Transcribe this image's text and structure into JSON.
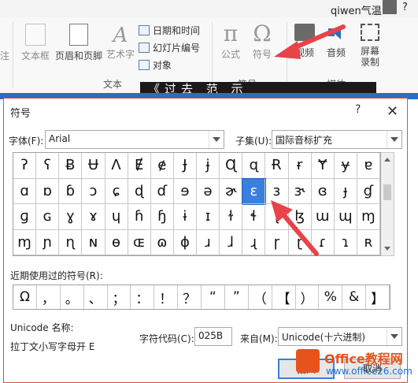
{
  "ribbon": {
    "user": "qiwen气温",
    "items": {
      "partial_left": "注",
      "textbox": "文本框",
      "header_footer": "页眉和页脚",
      "wordart": "艺术字",
      "datetime": "日期和时间",
      "slide_number": "幻灯片编号",
      "object": "对象",
      "equation": "公式",
      "symbol": "符号",
      "video": "视频",
      "audio": "音频",
      "screen_record": "屏幕录制"
    },
    "groups": {
      "text": "文本",
      "symbols": "符号",
      "media": "媒体"
    },
    "banner_text": "《过去  范  示"
  },
  "dialog": {
    "title": "符号",
    "help": "?",
    "close": "✕",
    "font_label": "字体(F):",
    "font_value": "Arial",
    "subset_label": "子集(U):",
    "subset_value": "国际音标扩充",
    "symbols": [
      [
        "ʔ",
        "ʕ",
        "Ƀ",
        "Ʉ",
        "Ʌ",
        "Ɇ",
        "ɇ",
        "Ɉ",
        "ɉ",
        "Ɋ",
        "ɋ",
        "Ɍ",
        "ɍ",
        "Ɏ",
        "ɏ",
        "ɐ"
      ],
      [
        "ɑ",
        "ɒ",
        "ɓ",
        "ɔ",
        "ɕ",
        "ɖ",
        "ɗ",
        "ɘ",
        "ə",
        "ɚ",
        "ɛ",
        "ɜ",
        "ɝ",
        "ɞ",
        "ɟ",
        "ɠ"
      ],
      [
        "ɡ",
        "ɢ",
        "ɣ",
        "ɤ",
        "ɥ",
        "ɦ",
        "ɧ",
        "ɨ",
        "ɪ",
        "ɫ",
        "ɬ",
        "ɭ",
        "ɮ",
        "ɯ",
        "ɰ",
        "ɱ"
      ],
      [
        "ɱ",
        "ɲ",
        "ɳ",
        "ɴ",
        "ɵ",
        "ɶ",
        "ɷ",
        "ɸ",
        "ɹ",
        "ɺ",
        "ɻ",
        "ɼ",
        "ɽ",
        "ɾ",
        "ɿ",
        "ʀ"
      ]
    ],
    "selected": {
      "row": 1,
      "col": 10
    },
    "recent_label": "近期使用过的符号(R):",
    "recent_symbols": [
      "Ω",
      "，",
      "。",
      "、",
      "；",
      "：",
      "！",
      "？",
      "“",
      "”",
      "（",
      "【",
      "）",
      "%",
      "&",
      "】"
    ],
    "unicode_name_label": "Unicode 名称:",
    "unicode_name_value": "拉丁文小写字母开 E",
    "char_code_label": "字符代码(C):",
    "char_code_value": "025B",
    "from_label": "来自(M):",
    "from_value": "Unicode(十六进制)",
    "insert_button": "插入",
    "cancel_button": "取消"
  },
  "watermark": {
    "line1": "Office教程网",
    "line2": "www.office26.com"
  },
  "colors": {
    "selection": "#3a7ee0",
    "arrow": "#e8424a",
    "ribbon_bg": "#f8f8f8",
    "accent_blue": "#2b6cc4"
  }
}
